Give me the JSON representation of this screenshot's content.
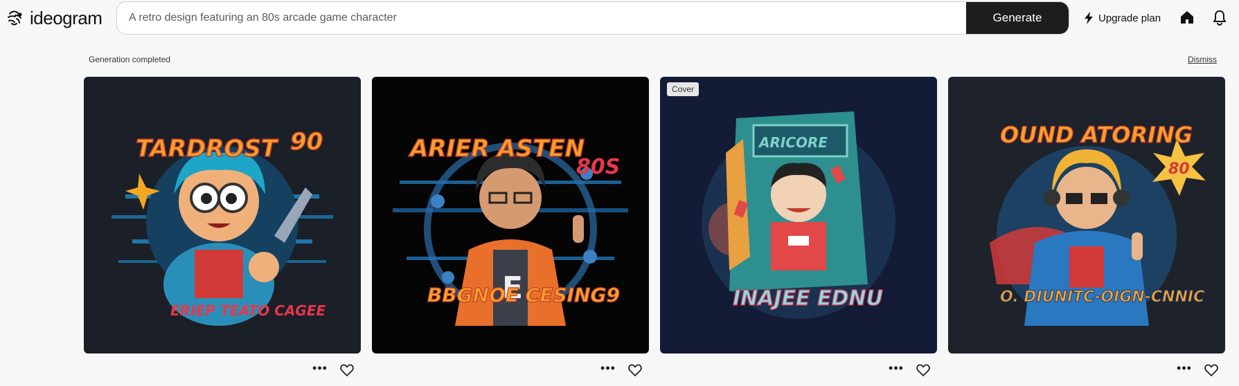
{
  "app": {
    "name": "ideogram"
  },
  "search": {
    "placeholder": "A retro design featuring an 80s arcade game character",
    "generate_label": "Generate"
  },
  "nav": {
    "upgrade_label": "Upgrade plan",
    "home_icon": "home-icon",
    "bell_icon": "bell-icon"
  },
  "status": {
    "message": "Generation completed",
    "dismiss_label": "Dismiss"
  },
  "cards": [
    {
      "bg": "#1b1f27",
      "badge": "",
      "top_text": "TARDROST",
      "num": "90",
      "bottom_text": "ERIEP TEATO CAGEE"
    },
    {
      "bg": "#050505",
      "badge": "",
      "top_text": "ARIER ASTEN",
      "num": "80S",
      "bottom_text": "BBGNOE CESING9"
    },
    {
      "bg": "#141b36",
      "badge": "Cover",
      "top_text": "ARICORE",
      "num": "",
      "bottom_text": "INAJEE EDNU"
    },
    {
      "bg": "#1e222b",
      "badge": "",
      "top_text": "OUND ATORING",
      "num": "80",
      "bottom_text": "O. DIUNITC-OIGN-CNNIC"
    }
  ],
  "card_actions": {
    "more_icon": "more-icon",
    "like_icon": "heart-icon"
  },
  "colors": {
    "accent": "#1d1d1d",
    "background": "#f7f7f7"
  }
}
